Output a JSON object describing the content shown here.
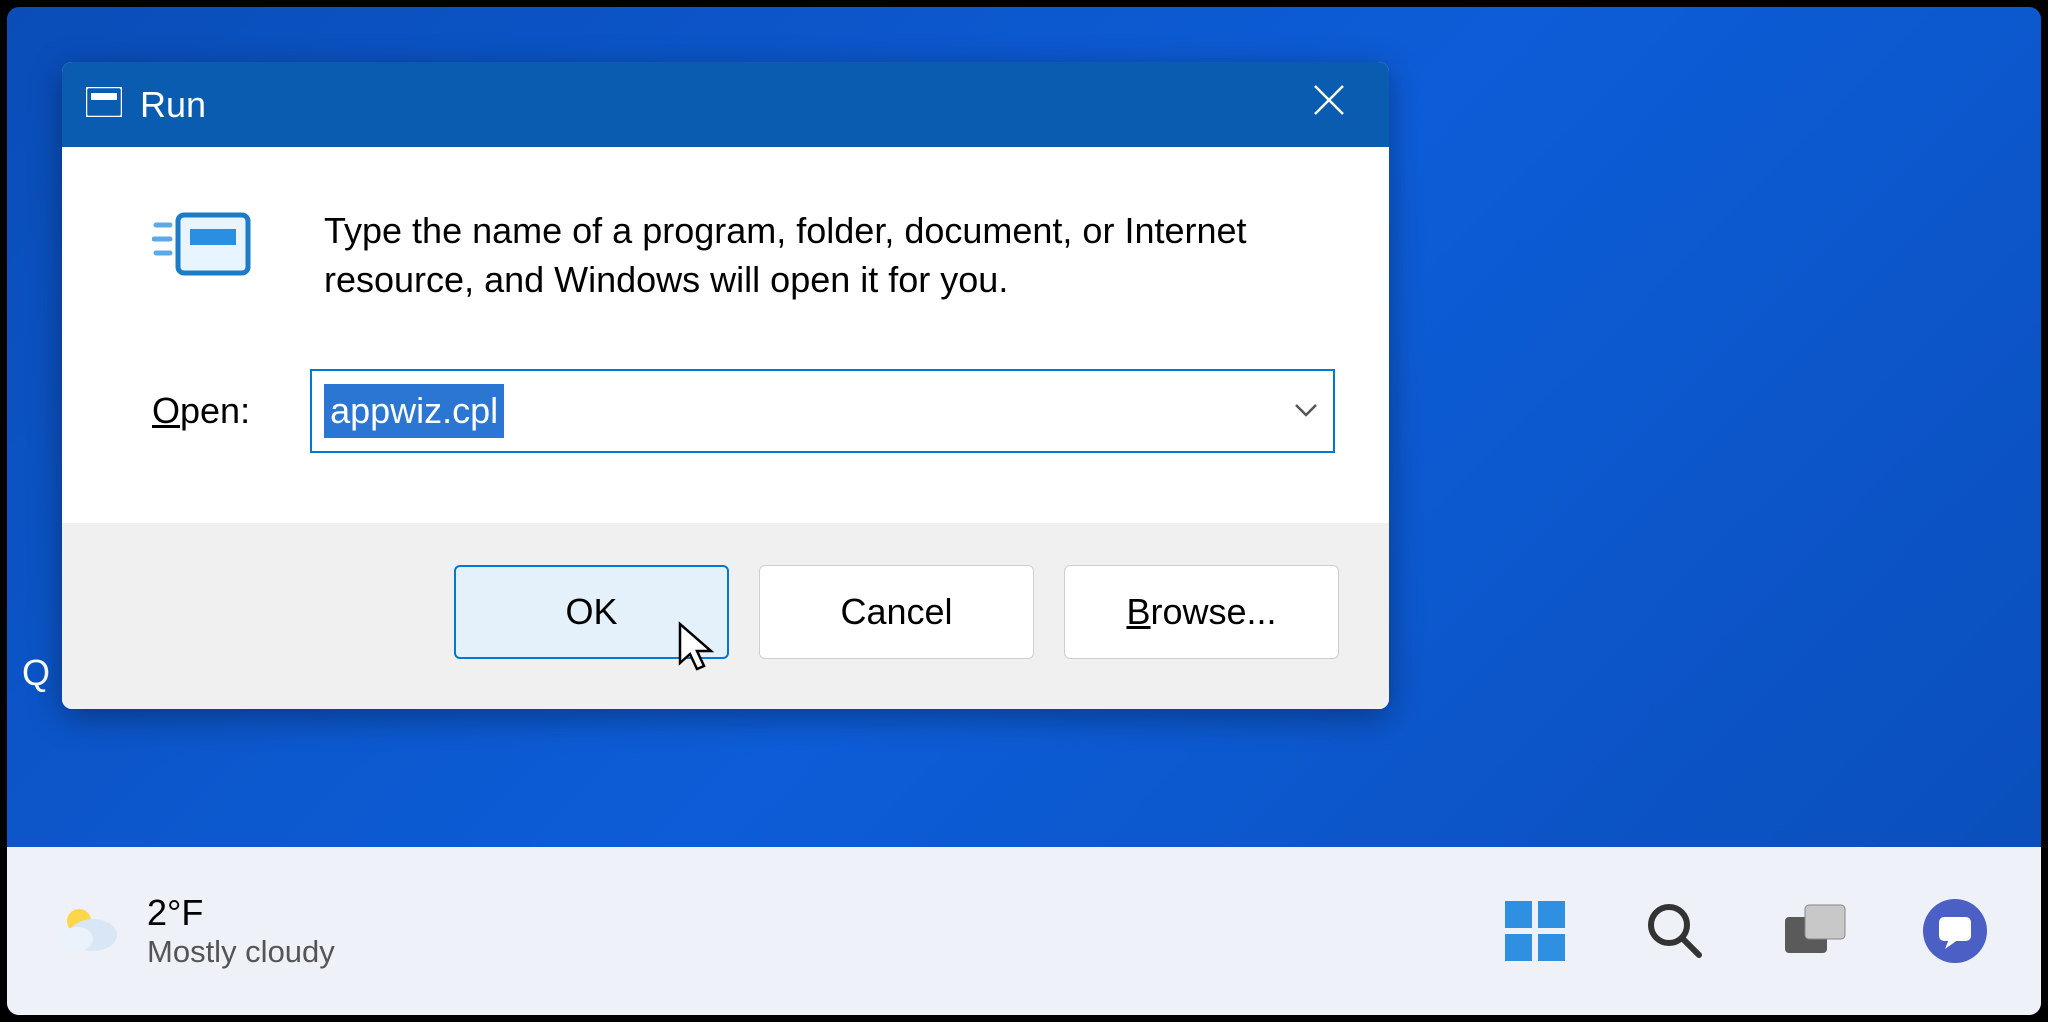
{
  "dialog": {
    "title": "Run",
    "description": "Type the name of a program, folder, document, or Internet resource, and Windows will open it for you.",
    "open_label": "Open:",
    "input_value": "appwiz.cpl",
    "buttons": {
      "ok": "OK",
      "cancel": "Cancel",
      "browse": "Browse..."
    }
  },
  "taskbar": {
    "weather": {
      "temp": "2°F",
      "condition": "Mostly cloudy"
    }
  },
  "desktop": {
    "widget_hint": "Q"
  }
}
